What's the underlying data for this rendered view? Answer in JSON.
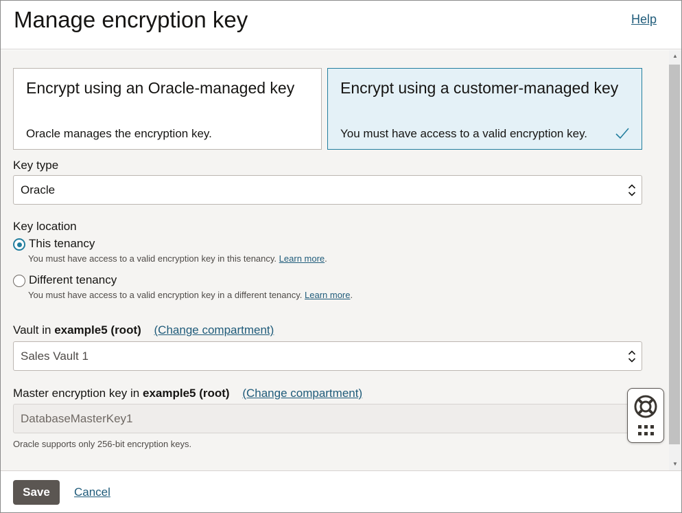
{
  "header": {
    "title": "Manage encryption key",
    "help": "Help"
  },
  "options": [
    {
      "title": "Encrypt using an Oracle-managed key",
      "description": "Oracle manages the encryption key.",
      "selected": false
    },
    {
      "title": "Encrypt using a customer-managed key",
      "description": "You must have access to a valid encryption key.",
      "selected": true
    }
  ],
  "key_type": {
    "label": "Key type",
    "value": "Oracle"
  },
  "key_location": {
    "label": "Key location",
    "options": [
      {
        "label": "This tenancy",
        "help": "You must have access to a valid encryption key in this tenancy.",
        "link": "Learn more",
        "end": ".",
        "checked": true
      },
      {
        "label": "Different tenancy",
        "help": "You must have access to a valid encryption key in a different tenancy.",
        "link": "Learn more",
        "end": ".",
        "checked": false
      }
    ]
  },
  "vault": {
    "label_prefix": "Vault in",
    "compartment": "example5 (root)",
    "change": "(Change compartment)",
    "value": "Sales Vault 1"
  },
  "master_key": {
    "label_prefix": "Master encryption key in",
    "compartment": "example5 (root)",
    "change": "(Change compartment)",
    "value": "DatabaseMasterKey1",
    "hint": "Oracle supports only 256-bit encryption keys."
  },
  "footer": {
    "save": "Save",
    "cancel": "Cancel"
  },
  "icons": {
    "check": "check-icon",
    "select": "updown-chevron-icon",
    "support": "lifebuoy-icon",
    "apps": "grid-icon"
  },
  "colors": {
    "accent": "#227e9e",
    "selected_card": "#e4f1f7",
    "save_button": "#5b5652",
    "link": "#1f5b7a"
  }
}
